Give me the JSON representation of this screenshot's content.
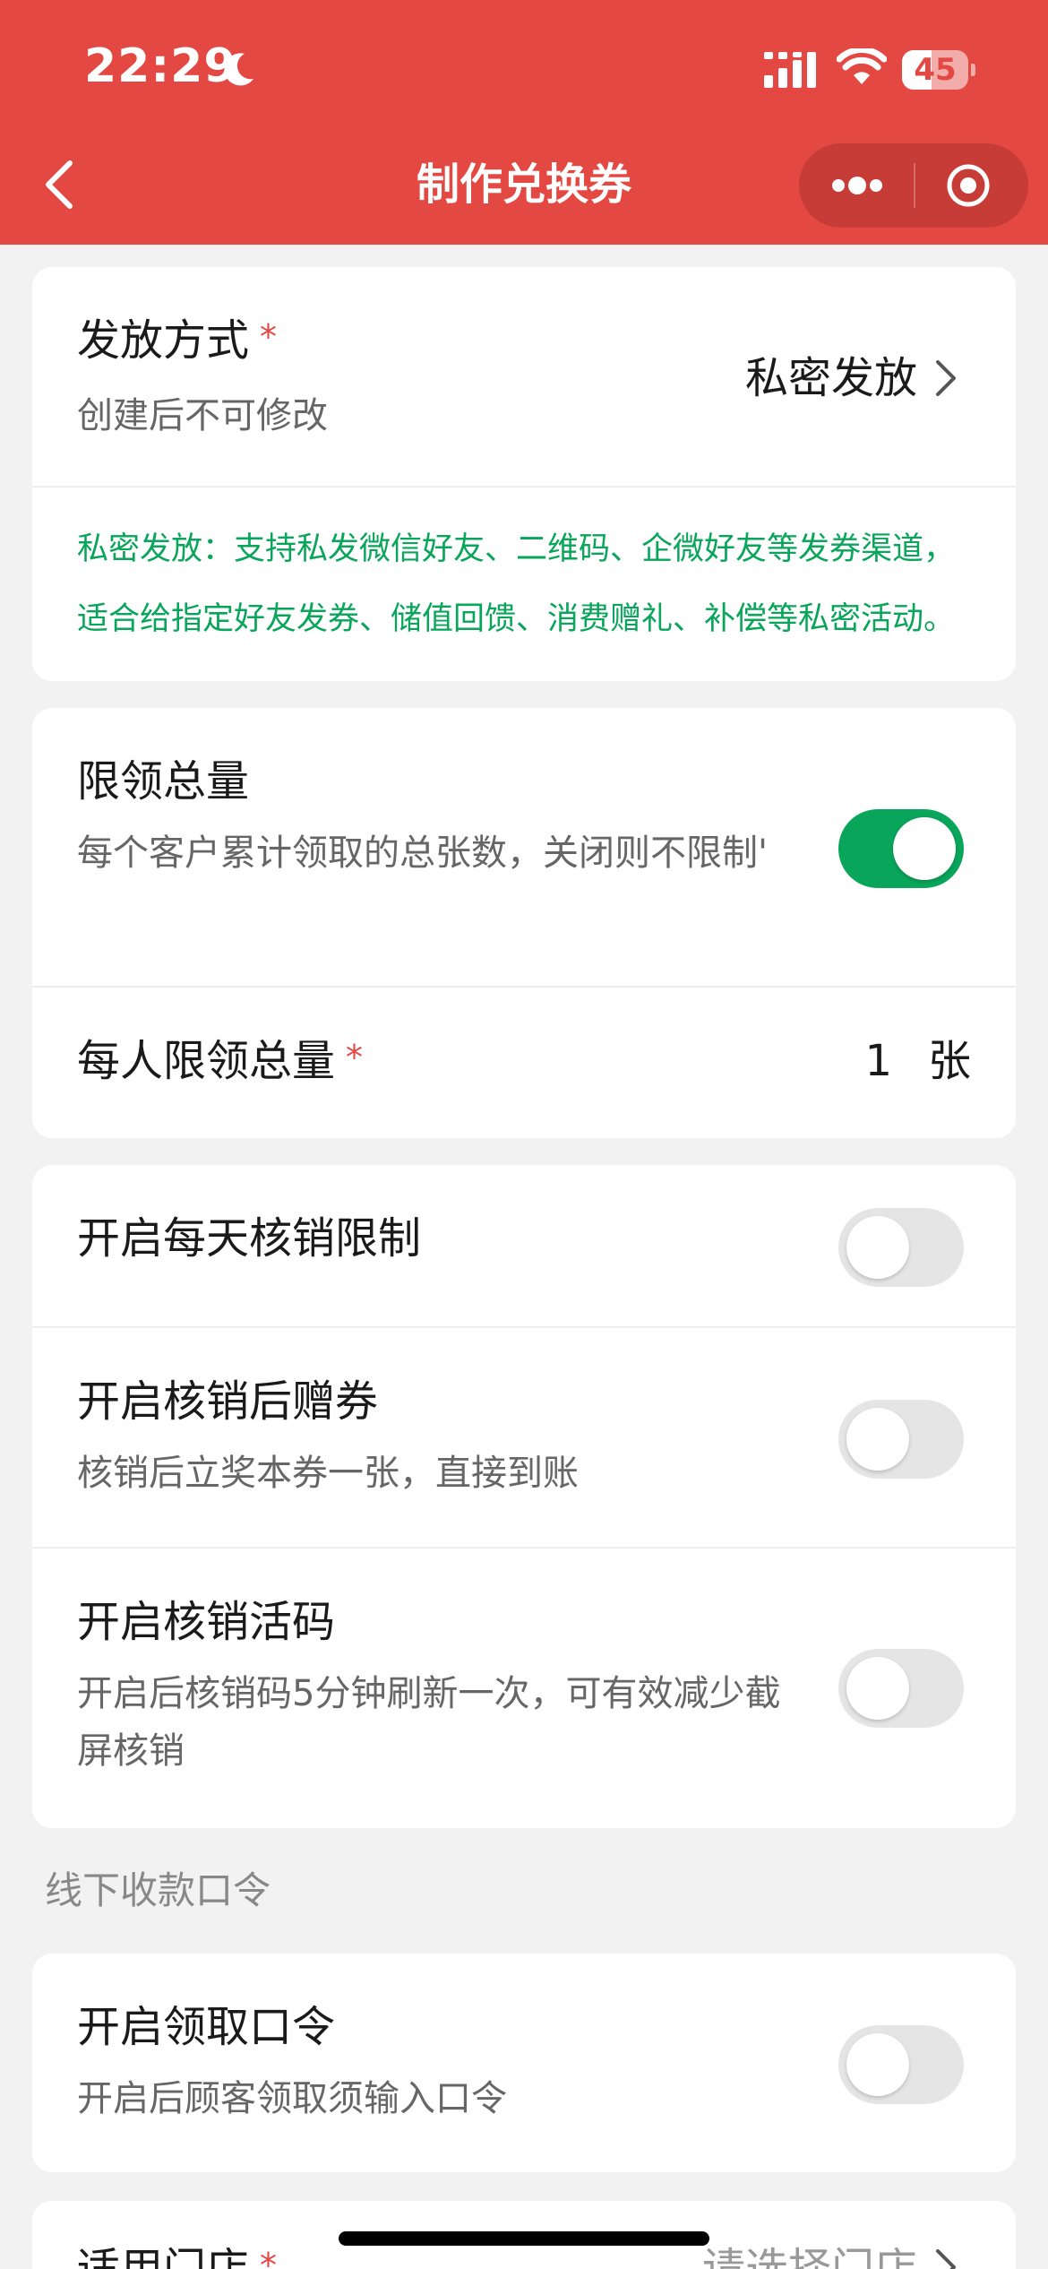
{
  "status_bar": {
    "time": "22:29",
    "battery": "45",
    "battery_level": 0.45
  },
  "nav": {
    "title": "制作兑换券"
  },
  "distribution": {
    "title": "发放方式",
    "required_mark": "*",
    "subtitle": "创建后不可修改",
    "value": "私密发放",
    "note": "私密发放：支持私发微信好友、二维码、企微好友等发券渠道，适合给指定好友发券、储值回馈、消费赠礼、补偿等私密活动。"
  },
  "limit_total": {
    "title": "限领总量",
    "subtitle": "每个客户累计领取的总张数，关闭则不限制'",
    "enabled": true
  },
  "per_person": {
    "title": "每人限领总量",
    "required_mark": "*",
    "value": "1",
    "unit": "张"
  },
  "daily_limit": {
    "title": "开启每天核销限制",
    "enabled": false
  },
  "gift_after": {
    "title": "开启核销后赠券",
    "subtitle": "核销后立奖本券一张，直接到账",
    "enabled": false
  },
  "live_code": {
    "title": "开启核销活码",
    "subtitle": "开启后核销码5分钟刷新一次，可有效减少截屏核销",
    "enabled": false
  },
  "section": {
    "label": "线下收款口令"
  },
  "claim_code": {
    "title": "开启领取口令",
    "subtitle": "开启后顾客领取须输入口令",
    "enabled": false
  },
  "store": {
    "title": "适用门店",
    "required_mark": "*",
    "placeholder": "请选择门店"
  }
}
